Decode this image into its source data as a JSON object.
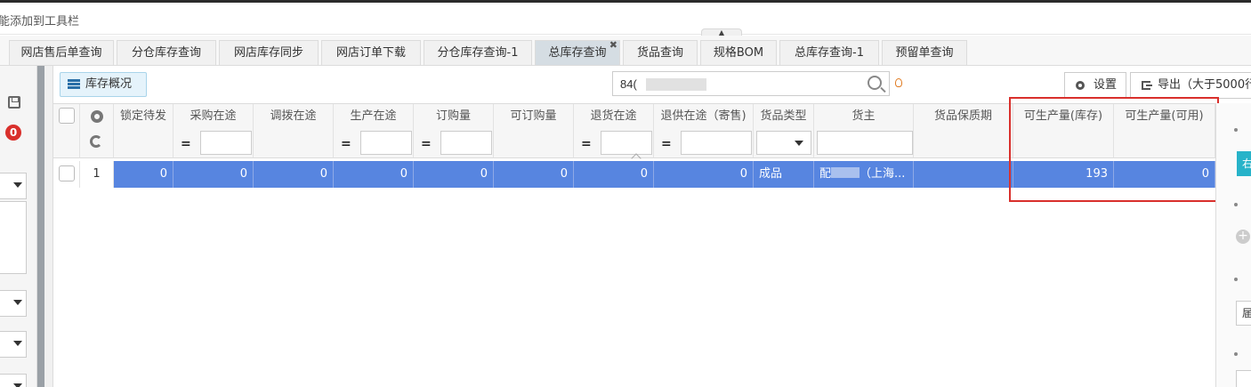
{
  "hint": {
    "text": "能添加到工具栏"
  },
  "collapse": {
    "glyph": "▲"
  },
  "tabs": [
    {
      "label": "网店售后单查询"
    },
    {
      "label": "分仓库存查询"
    },
    {
      "label": "网店库存同步"
    },
    {
      "label": "网店订单下载"
    },
    {
      "label": "分仓库存查询-1"
    },
    {
      "label": "总库存查询",
      "active": true,
      "close": "✖"
    },
    {
      "label": "货品查询"
    },
    {
      "label": "规格BOM"
    },
    {
      "label": "总库存查询-1"
    },
    {
      "label": "预留单查询"
    }
  ],
  "left_panel": {
    "badge": "0"
  },
  "toolbar": {
    "overview_label": "库存概况",
    "search_value": "84(",
    "settings_label": "设置",
    "export_label": "导出（大于5000行"
  },
  "grid": {
    "columns": [
      "锁定待发",
      "采购在途",
      "调拨在途",
      "生产在途",
      "订购量",
      "可订购量",
      "退货在途",
      "退供在途（寄售)",
      "货品类型",
      "货主",
      "货品保质期",
      "可生产量(库存)",
      "可生产量(可用)"
    ],
    "filter_eq": "=",
    "row": {
      "index": "1",
      "locked": "0",
      "purchase_transit": "0",
      "transfer_transit": "0",
      "production_transit": "0",
      "order_qty": "0",
      "orderable_qty": "0",
      "return_transit": "0",
      "consign_return_transit": "0",
      "goods_type": "成品",
      "owner_prefix": "配",
      "owner_suffix": "（上海...",
      "shelf_life": "",
      "producible_stock": "193",
      "producible_available": "0"
    }
  },
  "right_panel": {
    "teal_text": "右",
    "field_text": "届"
  },
  "colors": {
    "selected_row": "#5785e0",
    "highlight": "#d9302c",
    "accent": "#27b3c9"
  }
}
